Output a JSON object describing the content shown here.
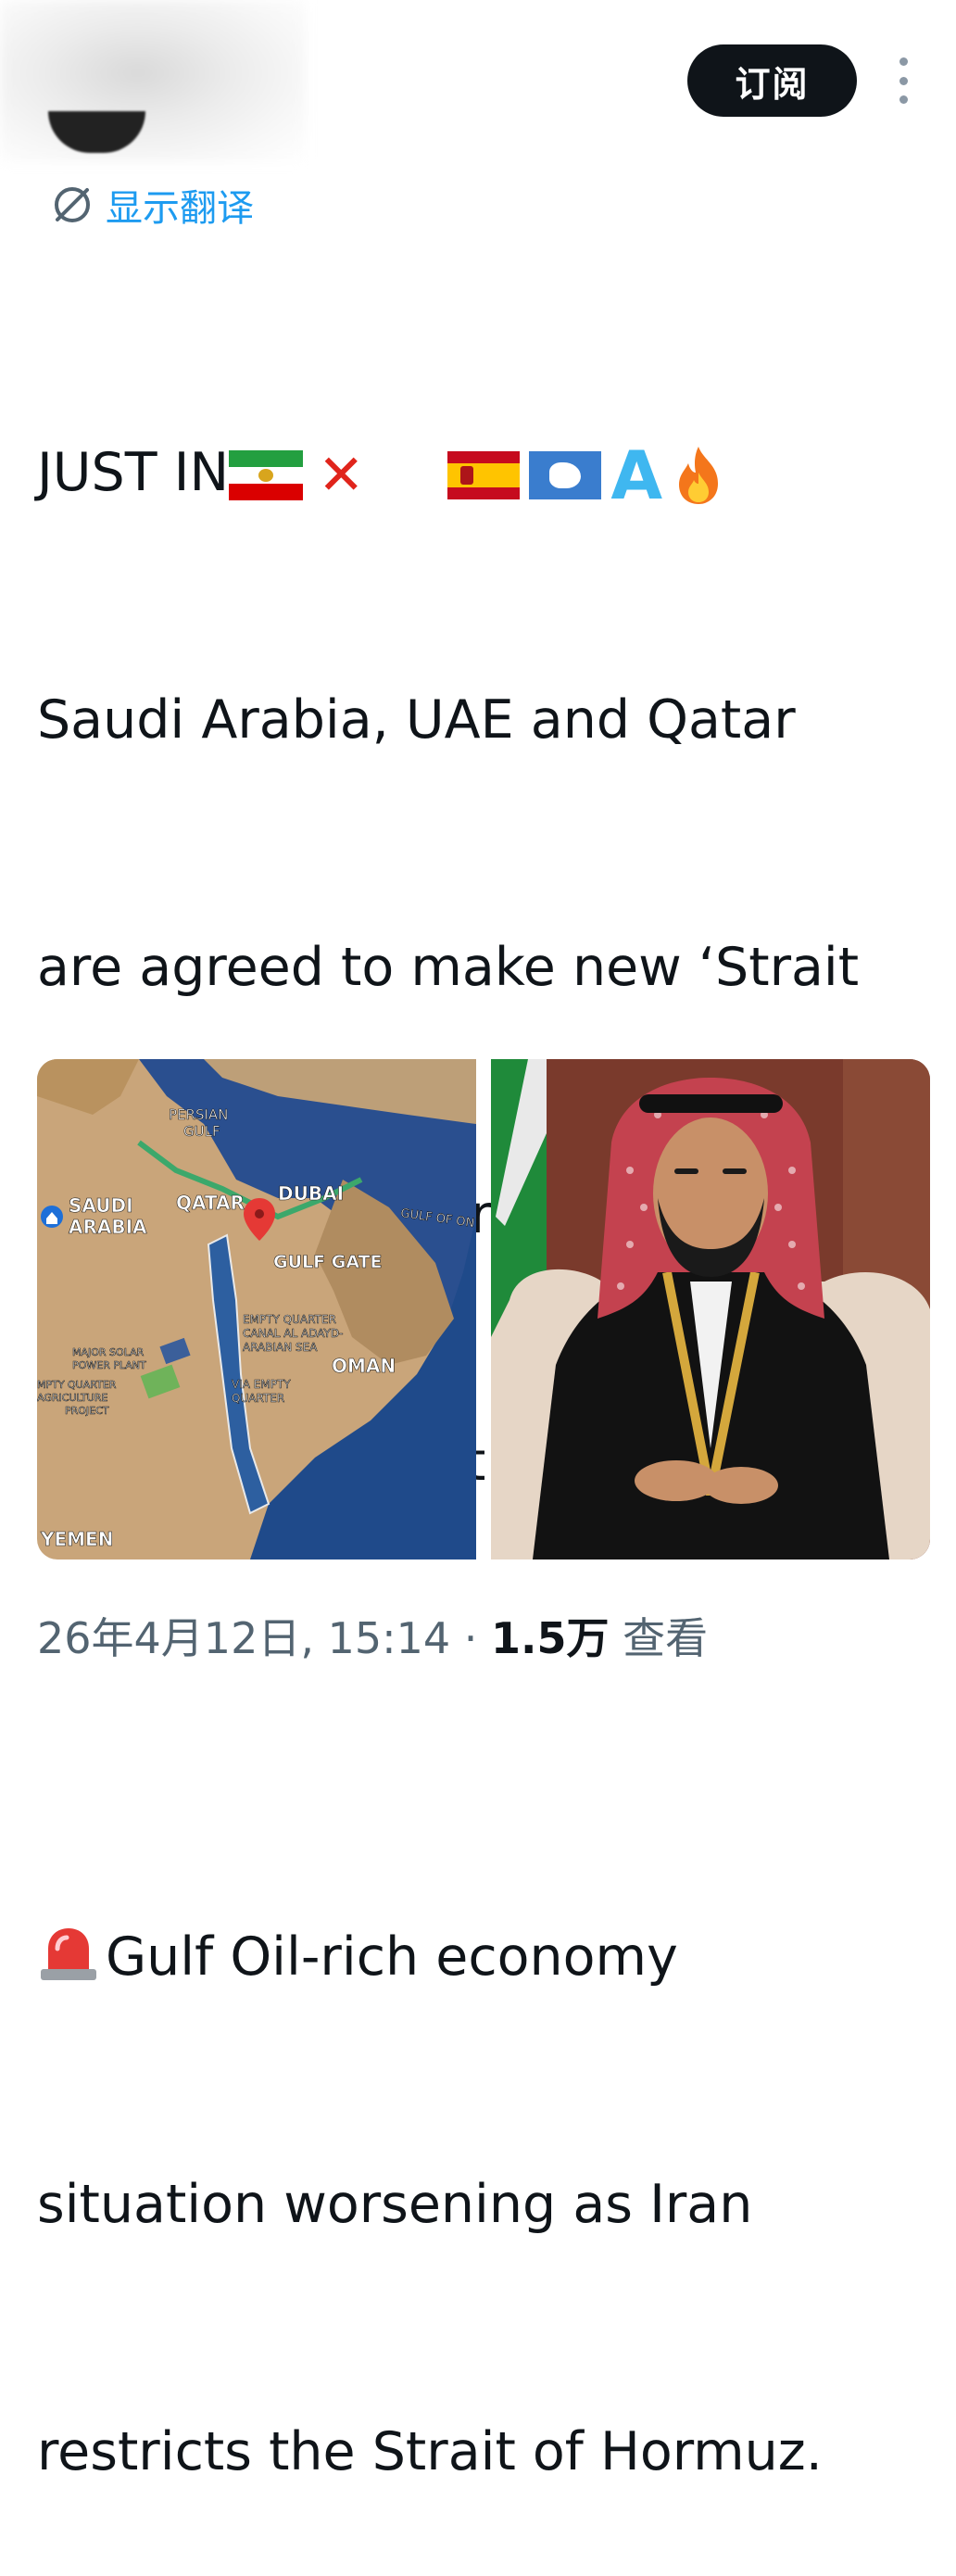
{
  "header": {
    "subscribe_label": "订阅",
    "more_icon": "more-vertical-icon"
  },
  "translate": {
    "label": "显示翻译",
    "icon": "translate-icon"
  },
  "tweet": {
    "line1": "JUST IN",
    "line2": "Saudi Arabia, UAE and Qatar",
    "line3": "are agreed to make new ‘Strait",
    "line4": "of Qatar’ if US/Israel failed to",
    "line5": "reopen the Strait of Hormuz.",
    "line6": "Gulf Oil-rich economy",
    "line7": "situation worsening as Iran",
    "line8": "restricts the Strait of Hormuz.",
    "emoji_letter": "A"
  },
  "map": {
    "persian_gulf": [
      "PERSIAN",
      "GULF"
    ],
    "saudi": [
      "SAUDI",
      "ARABIA"
    ],
    "qatar": "QATAR",
    "dubai": "DUBAI",
    "gulf_of_oman": "GULF OF ON",
    "gulf_gate": "GULF GATE",
    "canal": [
      "EMPTY QUARTER",
      "CANAL AL ADAYD-",
      "ARABIAN SEA"
    ],
    "oman": "OMAN",
    "solar": [
      "MAJOR SOLAR",
      "POWER PLANT"
    ],
    "agri": [
      "MPTY QUARTER",
      "AGRICULTURE",
      "PROJECT"
    ],
    "via": [
      "VIA EMPTY",
      "QUARTER"
    ],
    "yemen": "YEMEN"
  },
  "meta": {
    "date_time": "26年4月12日, 15:14 · ",
    "views_count": "1.5万",
    "views_label": " 查看"
  },
  "colors": {
    "accent_blue": "#1d9bf0",
    "text_dark": "#0f1419",
    "text_muted": "#536471"
  }
}
